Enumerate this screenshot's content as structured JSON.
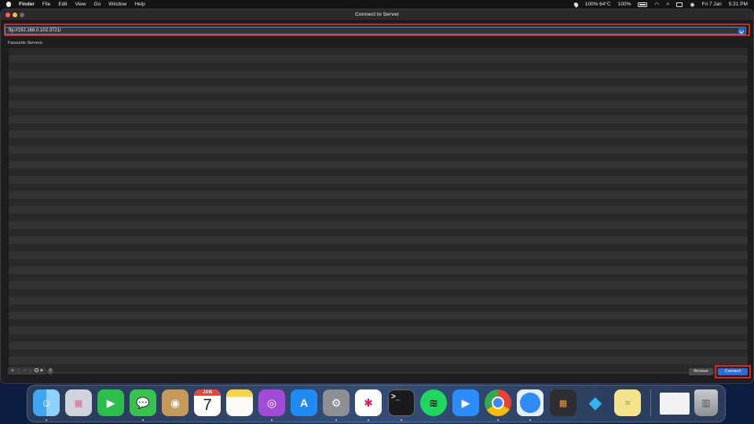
{
  "menubar": {
    "app_name": "Finder",
    "menus": [
      "File",
      "Edit",
      "View",
      "Go",
      "Window",
      "Help"
    ],
    "status": {
      "temp": "100% 64°C",
      "battery": "100%",
      "date": "Fri 7 Jan",
      "time": "5:21 PM"
    }
  },
  "window": {
    "title": "Connect to Server",
    "address": "ftp://192.168.0.102:3721/",
    "favourites_label": "Favourite Servers:",
    "controls": {
      "add": "+",
      "remove": "−",
      "action": "⊙"
    },
    "help_label": "?",
    "browse_label": "Browse",
    "connect_label": "Connect"
  },
  "dock": {
    "calendar_month": "JAN",
    "calendar_day": "7"
  },
  "colors": {
    "highlight": "#d32a1e",
    "accent": "#2f6bd8"
  }
}
